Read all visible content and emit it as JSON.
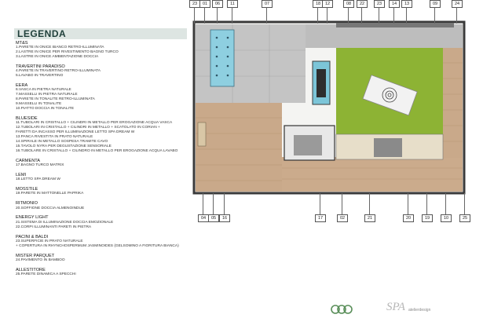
{
  "legend": {
    "title": "LEGENDA",
    "groups": [
      {
        "name": "MT&S",
        "items": [
          "1.PARETE IN ONICE BIANCO RETRO-ILLUMINATA",
          "2.LASTRE IN ONICE PER RIVESTIMENTO BAGNO TURCO",
          "3.LASTRE IN ONICE AMBIENTAZIONE DOCCIA"
        ]
      },
      {
        "name": "TRAVERTINI PARADISO",
        "items": [
          "4.PARETE IN TRAVERTINO RETRO-ILLUMINATA",
          "5.LAVABO IN TRAVERTINO"
        ]
      },
      {
        "name": "EERA",
        "items": [
          "6.VASCA IN PIETRA NATURALE",
          "7.MASSELLI IN PIETRA NATURALE",
          "8.PARETE IN TONALITE RETRO-ILLUMINATA",
          "9.MASSELLI IN TONALITE",
          "10.PIATTO DOCCIA IN TONALITE"
        ]
      },
      {
        "name": "BLUESIDE",
        "items": [
          "11.TUBOLARI IN CRISTALLO + CILINDRI IN METALLO PER EROGAZIONE ACQUA VASCA",
          "12.TUBOLARI IN CRISTALLO + CILINDRI IN METALLO + SCATOLATO IN CORIAN +",
          "     FARETTI DA INCASSO PER ILLUMINAZIONE LETTO SPA DREAM W",
          "13.PANCA RIVESTITA IN PRATO NATURALE",
          "14.SPIRALE IN METALLO SOSPESA TRAMITE CAVO",
          "15.TAVOLO NYRA PER DEGUSTAZIONE SENSORIALE",
          "16.TUBOLARE IN CRISTALLO + CILINDRO IN METALLO PER EROGAZIONE ACQUA LAVABO"
        ]
      },
      {
        "name": "CARMENTA",
        "items": [
          "17.BAGNO TURCO MATRIX"
        ]
      },
      {
        "name": "LEMI",
        "items": [
          "18.LETTO SPA DREAM W"
        ]
      },
      {
        "name": "MOSSTILE",
        "items": [
          "19.PARETE IN MATTONELLE PAPRIKA"
        ]
      },
      {
        "name": "RITMONIO",
        "items": [
          "20.SOFFIONE DOCCIA ALMENOINDUE"
        ]
      },
      {
        "name": "ENERGY LIGHT",
        "items": [
          "21.SISTEMA DI ILLUMINAZIONE DOCCIA EMOZIONALE",
          "22.CORPI ILLUMINANTI PARETI IN PIETRA"
        ]
      },
      {
        "name": "PACINI & BALDI",
        "items": [
          "23.SUPERFICIE IN PRATO NATURALE",
          "   + COPERTURA IN RHYNCHOSPERMUM JASMINOIDES (GELSOMINO A FIORITURA BIANCA)"
        ]
      },
      {
        "name": "MISTER PARQUET",
        "items": [
          "24.PAVIMENTO IN BAMBOO"
        ]
      },
      {
        "name": "ALLESTITORE",
        "items": [
          "25.PARETE DINAMICA A SPECCHI"
        ]
      }
    ]
  },
  "plan": {
    "top_labels": [
      "23",
      "01",
      "06",
      "11",
      "07",
      "18",
      "12",
      "08",
      "22",
      "23",
      "14",
      "13",
      "09",
      "24"
    ],
    "bottom_labels": [
      "04",
      "05",
      "16",
      "17",
      "02",
      "21",
      "20",
      "19",
      "10",
      "25"
    ],
    "colors": {
      "grass": "#8db334",
      "wood": "#c9a98a",
      "stone": "#b9b9b9",
      "glass": "#8ecfe0",
      "wall": "#555555"
    }
  },
  "footer": {
    "brand": "SPA",
    "tagline": "atelierdesign"
  }
}
